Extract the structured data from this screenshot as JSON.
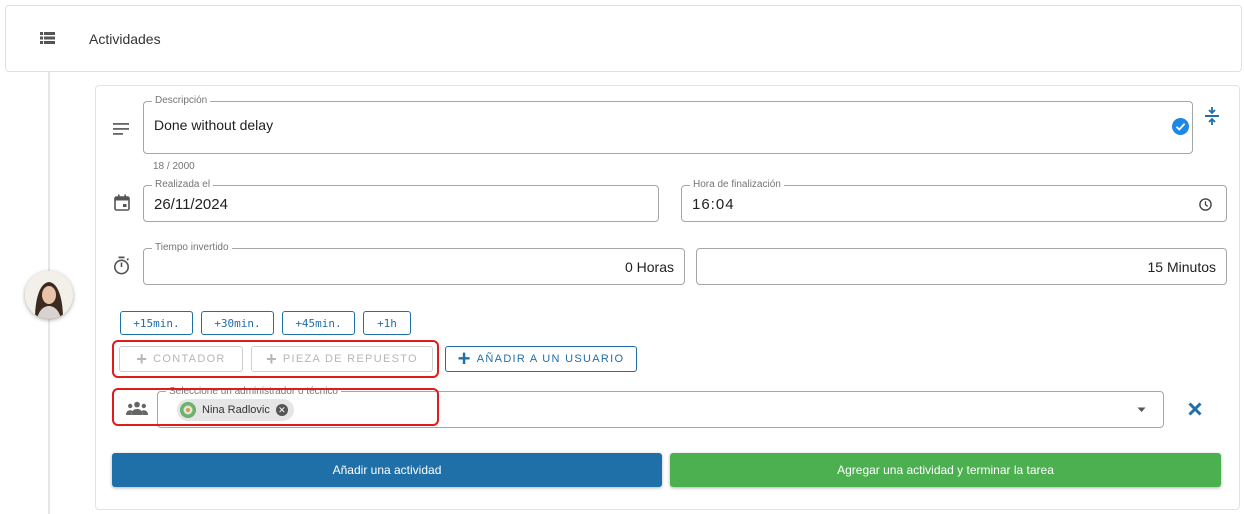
{
  "header": {
    "title": "Actividades",
    "icon": "list-icon"
  },
  "description": {
    "label": "Descripción",
    "value": "Done without delay",
    "counter": "18 / 2000"
  },
  "completed_date": {
    "label": "Realizada el",
    "value": "26/11/2024"
  },
  "end_time": {
    "label": "Hora de finalización",
    "value": "16:04"
  },
  "time_spent": {
    "label": "Tiempo invertido",
    "hours": "0 Horas",
    "minutes": "15 Minutos"
  },
  "quick_add": [
    "+15min.",
    "+30min.",
    "+45min.",
    "+1h"
  ],
  "actions": {
    "counter": "CONTADOR",
    "spare_part": "PIEZA DE REPUESTO",
    "add_user": "AÑADIR A UN USUARIO"
  },
  "assignee": {
    "label": "Seleccione un administrador o técnico",
    "selected": "Nina Radlovic"
  },
  "buttons": {
    "add_activity": "Añadir una actividad",
    "add_and_finish": "Agregar una actividad y terminar la tarea"
  },
  "colors": {
    "primary": "#1f6fa8",
    "success": "#4caf50",
    "highlight": "#e01b1b",
    "check": "#1e88e5"
  }
}
